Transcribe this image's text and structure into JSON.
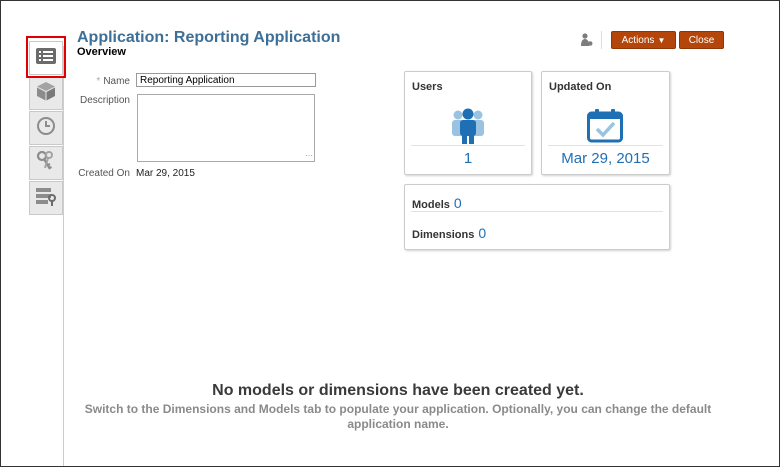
{
  "header": {
    "title": "Application: Reporting Application",
    "subtitle": "Overview",
    "actions_label": "Actions",
    "close_label": "Close"
  },
  "side_tabs": [
    {
      "icon": "overview-list-icon",
      "active": true
    },
    {
      "icon": "cube-icon",
      "active": false
    },
    {
      "icon": "clock-icon",
      "active": false
    },
    {
      "icon": "keys-icon",
      "active": false
    },
    {
      "icon": "server-key-icon",
      "active": false
    }
  ],
  "form": {
    "name_label": "Name",
    "name_value": "Reporting Application",
    "description_label": "Description",
    "description_value": "",
    "created_on_label": "Created On",
    "created_on_value": "Mar 29, 2015"
  },
  "cards": {
    "users_title": "Users",
    "users_count": "1",
    "updated_title": "Updated On",
    "updated_value": "Mar 29, 2015",
    "models_label": "Models",
    "models_count": "0",
    "dimensions_label": "Dimensions",
    "dimensions_count": "0"
  },
  "empty_state": {
    "heading": "No models or dimensions have been created yet.",
    "message": "Switch to the Dimensions and Models tab to populate your application. Optionally, you can change the default application name."
  },
  "colors": {
    "title_blue": "#3e6f96",
    "accent_blue": "#1f6fb5",
    "button_brown": "#b4460b",
    "highlight_red": "#e00000"
  }
}
